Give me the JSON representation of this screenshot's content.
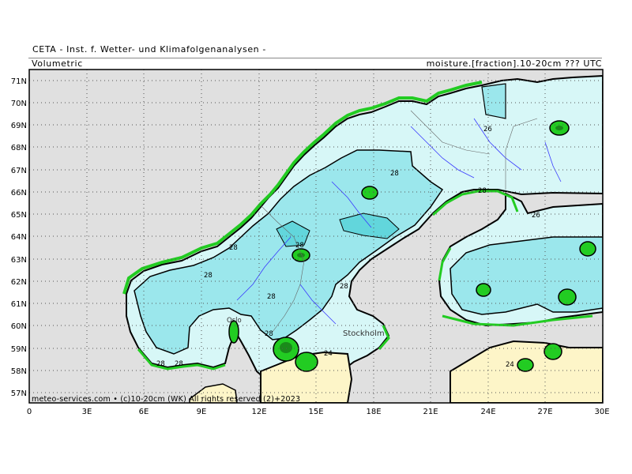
{
  "header": {
    "title": "CETA - Inst. f. Wetter- und Klimafolgenanalysen -",
    "variable": "Volumetric",
    "product": "moisture.[fraction].10-20cm ??? UTC"
  },
  "credit": "meteo-services.com • (c)10-20cm (WK) All rights reserved (2)+2023",
  "axes": {
    "x_ticks": [
      "0",
      "3E",
      "6E",
      "9E",
      "12E",
      "15E",
      "18E",
      "21E",
      "24E",
      "27E",
      "30E"
    ],
    "y_ticks": [
      "71N",
      "70N",
      "69N",
      "68N",
      "67N",
      "66N",
      "65N",
      "64N",
      "63N",
      "62N",
      "61N",
      "60N",
      "59N",
      "58N",
      "57N"
    ]
  },
  "places": [
    {
      "name": "Oslo"
    },
    {
      "name": "Stockholm"
    }
  ],
  "contour_labels": [
    "26",
    "28",
    "28",
    "26",
    "28",
    "28",
    "28",
    "28",
    "28",
    "24",
    "24",
    "28",
    "28",
    "28"
  ],
  "legend_colors": {
    "water_background": "#e0e0e0",
    "level_dry": "#fdf5c8",
    "level_low": "#d7f7f7",
    "level_mid": "#9be7ec",
    "level_high": "#62d6dc",
    "wet_patch": "#22cc22",
    "wet_core": "#1a8a1a"
  }
}
